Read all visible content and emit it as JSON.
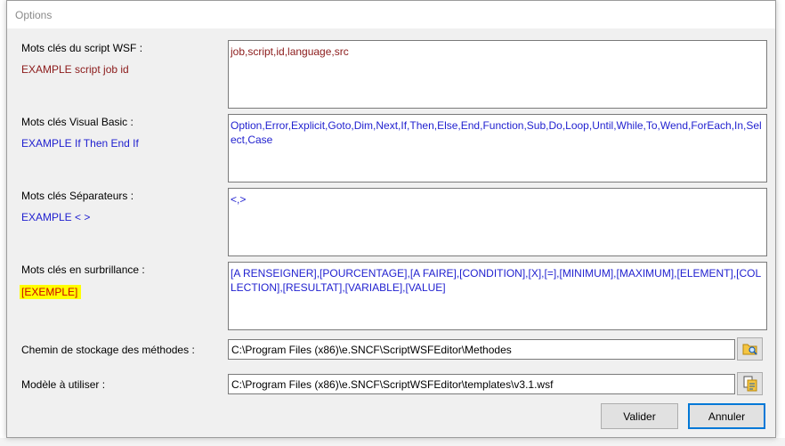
{
  "dialog": {
    "title": "Options"
  },
  "fields": {
    "wsf": {
      "label": "Mots clés du script WSF :",
      "example": "EXAMPLE script job id",
      "value": "job,script,id,language,src"
    },
    "vb": {
      "label": "Mots clés Visual Basic :",
      "example": "EXAMPLE If Then End If",
      "value": "Option,Error,Explicit,Goto,Dim,Next,If,Then,Else,End,Function,Sub,Do,Loop,Until,While,To,Wend,ForEach,In,Select,Case"
    },
    "separators": {
      "label": "Mots clés Séparateurs :",
      "example": "EXAMPLE < >",
      "value": "<,>"
    },
    "highlight": {
      "label": "Mots clés en surbrillance :",
      "example": "[EXEMPLE]",
      "value": "[A RENSEIGNER],[POURCENTAGE],[A FAIRE],[CONDITION],[X],[=],[MINIMUM],[MAXIMUM],[ELEMENT],[COLLECTION],[RESULTAT],[VARIABLE],[VALUE]"
    },
    "methods_path": {
      "label": "Chemin de stockage des méthodes :",
      "value": "C:\\Program Files (x86)\\e.SNCF\\ScriptWSFEditor\\Methodes",
      "browse_icon": "folder-search-icon"
    },
    "template": {
      "label": "Modèle à utiliser :",
      "value": "C:\\Program Files (x86)\\e.SNCF\\ScriptWSFEditor\\templates\\v3.1.wsf",
      "browse_icon": "file-open-icon"
    }
  },
  "buttons": {
    "ok": "Valider",
    "cancel": "Annuler"
  },
  "colors": {
    "wsf_text": "#8b1a1a",
    "vb_text": "#1f1fcf",
    "highlight_bg": "#ffff00",
    "highlight_text": "#cc0000",
    "primary_border": "#0078d7"
  }
}
